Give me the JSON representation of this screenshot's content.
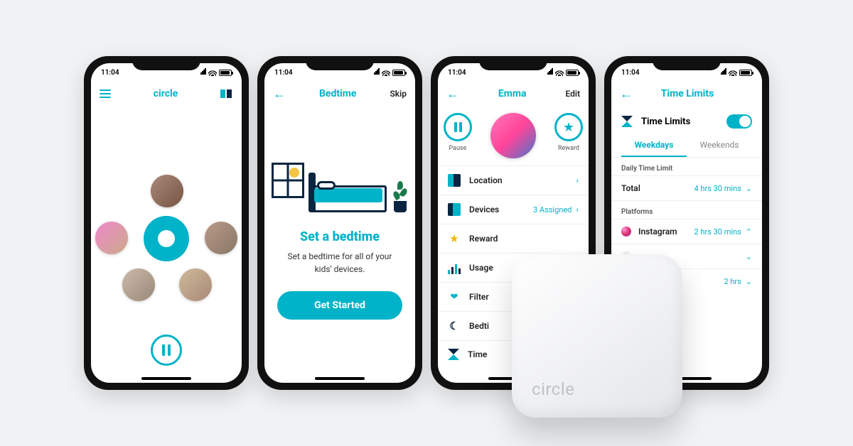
{
  "statusbar": {
    "time": "11:04"
  },
  "brand": {
    "name": "circle"
  },
  "phone1": {
    "title": "circle",
    "pause_label": "Pause"
  },
  "phone2": {
    "nav_back": "←",
    "title": "Bedtime",
    "skip": "Skip",
    "heading": "Set a bedtime",
    "body": "Set a bedtime for all of your kids' devices.",
    "cta": "Get Started"
  },
  "phone3": {
    "nav_back": "←",
    "profile_name": "Emma",
    "edit": "Edit",
    "pause": "Pause",
    "reward": "Reward",
    "rows": {
      "location": "Location",
      "devices": "Devices",
      "devices_val": "3 Assigned",
      "rewards": "Reward",
      "usage": "Usage",
      "filter": "Filter",
      "bedtime": "Bedti",
      "time": "Time"
    }
  },
  "phone4": {
    "nav_back": "←",
    "title": "Time Limits",
    "toggle_label": "Time Limits",
    "tabs": {
      "weekdays": "Weekdays",
      "weekends": "Weekends"
    },
    "sections": {
      "daily": "Daily Time Limit",
      "platforms": "Platforms"
    },
    "total_label": "Total",
    "total_val": "4 hrs 30 mins",
    "instagram": "Instagram",
    "instagram_val": "2 hrs 30 mins",
    "row3_val": "2 hrs"
  },
  "device": {
    "logo": "circle"
  }
}
